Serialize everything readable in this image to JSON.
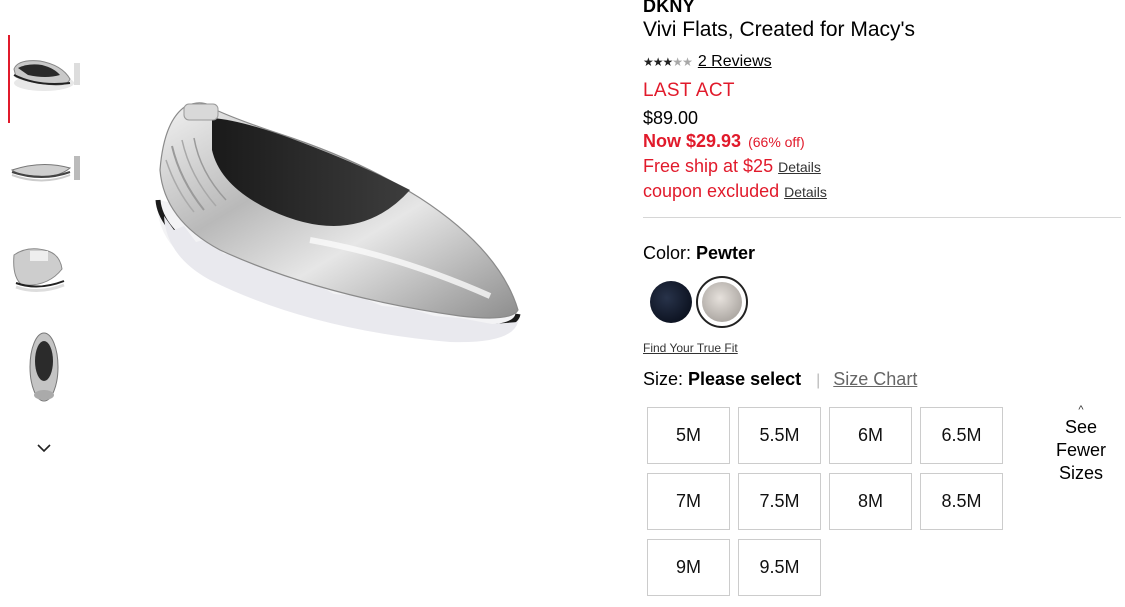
{
  "product": {
    "brand": "DKNY",
    "title": "Vivi Flats, Created for Macy's",
    "rating_stars": 3,
    "rating_max": 5,
    "reviews_label": "2 Reviews",
    "badge": "LAST ACT",
    "original_price": "$89.00",
    "now_price": "Now $29.93",
    "percent_off": "(66% off)",
    "promo_ship": "Free ship at $25",
    "promo_coupon": "coupon excluded",
    "details_label": "Details"
  },
  "color": {
    "label": "Color:",
    "selected": "Pewter",
    "swatches": [
      {
        "name": "Black",
        "hex": "#131a2b"
      },
      {
        "name": "Pewter",
        "hex": "#c8c3be"
      }
    ]
  },
  "fit": {
    "link": "Find Your True Fit"
  },
  "size": {
    "label": "Size:",
    "selected": "Please select",
    "chart_link": "Size Chart",
    "options": [
      "5M",
      "5.5M",
      "6M",
      "6.5M",
      "7M",
      "7.5M",
      "8M",
      "8.5M",
      "9M",
      "9.5M"
    ],
    "fewer_label": "See Fewer Sizes"
  },
  "gallery": {
    "thumbnail_count": 4,
    "active_index": 0,
    "accent": "#e11a2b"
  },
  "icons": {
    "stars": "star-icon",
    "scroll_down": "chevron-down-icon",
    "collapse": "chevron-up-icon"
  }
}
